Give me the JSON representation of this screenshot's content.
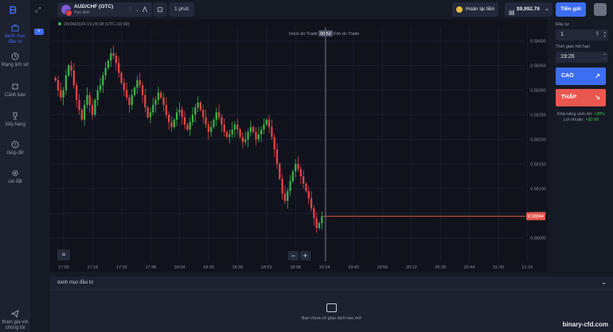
{
  "sidebar": {
    "items": [
      {
        "label": "danh mục đầu tư",
        "active": true,
        "icon": "briefcase-icon"
      },
      {
        "label": "Mạng lịch sử",
        "icon": "history-icon"
      },
      {
        "label": "Cảnh báo",
        "icon": "alarm-icon"
      },
      {
        "label": "Xếp hạng",
        "icon": "trophy-icon"
      },
      {
        "label": "Giúp đỡ",
        "icon": "help-icon"
      },
      {
        "label": "cài đặt",
        "icon": "gear-icon"
      },
      {
        "label": "tham gia với chúng tôi",
        "icon": "telegram-icon"
      }
    ]
  },
  "topbar": {
    "asset_name": "AUD/CHF (OTC)",
    "asset_sub": "Hạn định",
    "timeframe": "1 phút",
    "refund_label": "Hoàn lại tiền",
    "balance": "$9,992.78",
    "deposit_label": "Tiền gửi",
    "add_label": "+"
  },
  "chart": {
    "timestamp": "20/04/2024  19:25:08  (UTC-03:00)",
    "trade_start_label": "Inicio do Trade",
    "trade_timer": "00:52",
    "trade_end_label": "Fim do Trade",
    "current_price": "0.58044",
    "zoom_out": "−",
    "zoom_in": "+",
    "indicator_icon": "sliders-icon",
    "colors": {
      "up": "#3bb24a",
      "down": "#e04545",
      "price_line": "#e9574e"
    }
  },
  "chart_data": {
    "type": "candlestick",
    "y_ticks": [
      "0.58400",
      "0.58350",
      "0.58300",
      "0.58250",
      "0.58200",
      "0.58150",
      "0.58100",
      "0.58050",
      "0.58000"
    ],
    "x_ticks": [
      "17:00",
      "17:16",
      "17:32",
      "17:48",
      "18:04",
      "18:20",
      "18:36",
      "18:52",
      "19:08",
      "19:24",
      "19:40",
      "19:56",
      "20:12",
      "20:28",
      "20:44",
      "21:00",
      "21:16",
      "2"
    ],
    "ylim": [
      0.57975,
      0.58425
    ],
    "close_path": [
      0.5832,
      0.583,
      0.58285,
      0.583,
      0.5833,
      0.5835,
      0.5834,
      0.5831,
      0.5828,
      0.5826,
      0.5824,
      0.5827,
      0.5829,
      0.5827,
      0.5825,
      0.5828,
      0.583,
      0.5831,
      0.5833,
      0.58345,
      0.5836,
      0.58375,
      0.5837,
      0.58355,
      0.58335,
      0.58315,
      0.583,
      0.58285,
      0.5827,
      0.5829,
      0.58305,
      0.5832,
      0.5831,
      0.5829,
      0.58265,
      0.58245,
      0.58255,
      0.5827,
      0.5828,
      0.58295,
      0.58285,
      0.5827,
      0.5825,
      0.58235,
      0.58225,
      0.5824,
      0.58255,
      0.5826,
      0.58245,
      0.5823,
      0.5822,
      0.58235,
      0.5825,
      0.58265,
      0.58275,
      0.5826,
      0.58245,
      0.5823,
      0.58215,
      0.58225,
      0.5824,
      0.58255,
      0.58245,
      0.5823,
      0.58215,
      0.58205,
      0.5821,
      0.5822,
      0.5823,
      0.5822,
      0.58205,
      0.58195,
      0.582,
      0.58215,
      0.58225,
      0.58215,
      0.582,
      0.5821,
      0.5822,
      0.5823,
      0.5824,
      0.58225,
      0.58205,
      0.5818,
      0.5815,
      0.5812,
      0.5809,
      0.58075,
      0.58095,
      0.58115,
      0.58135,
      0.5815,
      0.5814,
      0.58125,
      0.5811,
      0.58095,
      0.5808,
      0.5806,
      0.5804,
      0.5802,
      0.5803,
      0.58044
    ]
  },
  "panel": {
    "amount_label": "Đầu tư",
    "amount_value": "1",
    "amount_unit": "$",
    "expiry_label": "Thời gian hết hạn",
    "expiry_value": "19:26",
    "up_label": "CAO",
    "down_label": "THẤP",
    "payout_label": "Khả năng sinh lời:",
    "payout_value": "+88%",
    "profit_label": "Lợi nhuận:",
    "profit_value": "+$0.88"
  },
  "bottom": {
    "title": "danh mục đầu tư",
    "empty_text": "Bạn chưa có giao dịch nào mở"
  },
  "watermark": "binary-cfd.com"
}
